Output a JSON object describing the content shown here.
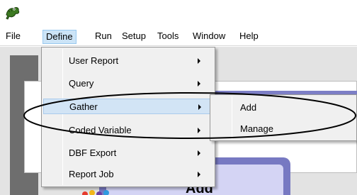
{
  "menu_bar": {
    "items": [
      "File",
      "Define",
      "Run",
      "Setup",
      "Tools",
      "Window",
      "Help"
    ],
    "active": "Define"
  },
  "define_menu": {
    "items": [
      {
        "label": "User Report",
        "has_submenu": true
      },
      {
        "label": "Query",
        "has_submenu": true
      },
      {
        "label": "Gather",
        "has_submenu": true,
        "highlighted": true
      },
      {
        "label": "Coded Variable",
        "has_submenu": true
      },
      {
        "label": "DBF Export",
        "has_submenu": true
      },
      {
        "label": "Report Job",
        "has_submenu": true
      }
    ]
  },
  "gather_submenu": {
    "items": [
      "Add",
      "Manage"
    ]
  },
  "background": {
    "partial_text": "Add"
  },
  "colors": {
    "menu_highlight": "#d2e4f5",
    "menu_background": "#f0f0f0",
    "annotation_ellipse": "#000000",
    "band_accent": "#7d7fc6"
  },
  "icons": {
    "app_icon": "green-frog-app-icon"
  }
}
